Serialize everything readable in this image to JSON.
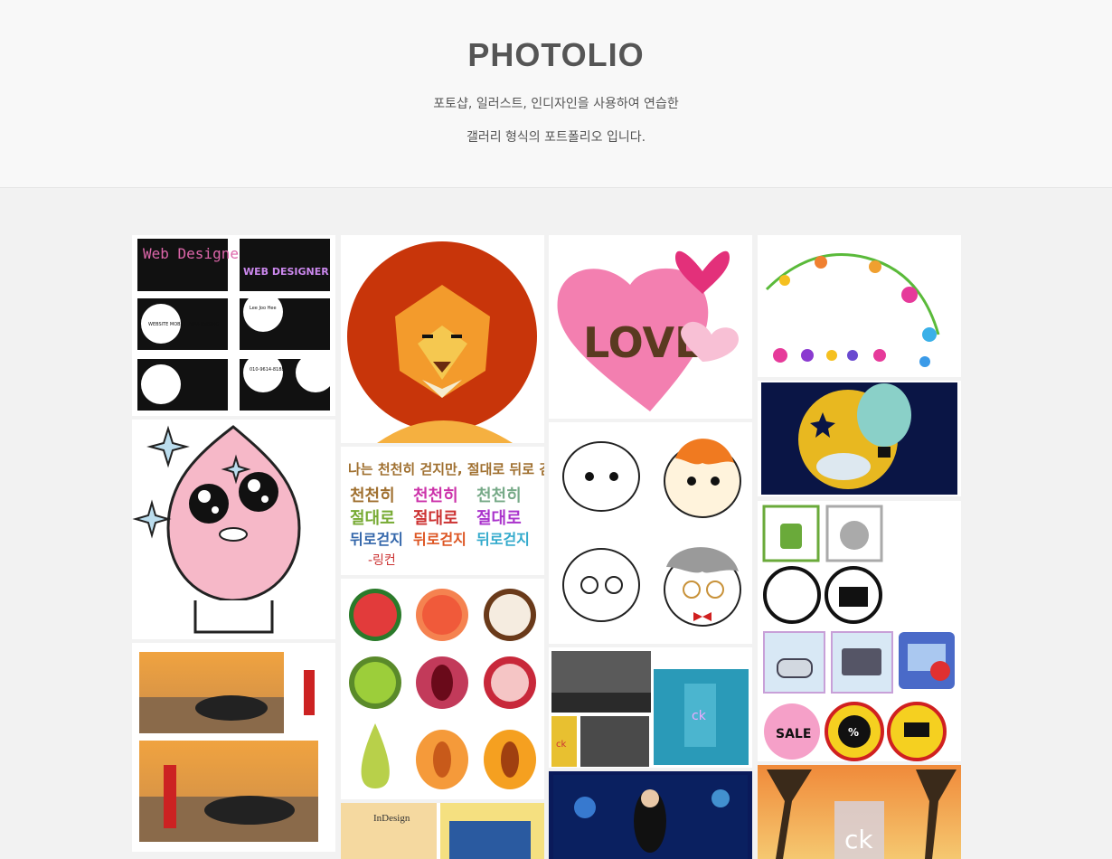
{
  "header": {
    "title": "PHOTOLIO",
    "subtitle_line1": "포토샵, 일러스트, 인디자인을 사용하여 연습한",
    "subtitle_line2": "갤러리 형식의 포트폴리오 입니다."
  },
  "gallery": {
    "items": [
      {
        "text_a": "Web Designer",
        "text_b": "WEB DESIGNER",
        "name": "Lee Joo Hee",
        "phone": "010-9614-8188",
        "small": "WEBSITE MOBILE ADVERTISING"
      },
      {
        "text": ""
      },
      {
        "text": "LOVE"
      },
      {
        "text": ""
      },
      {
        "text": ""
      },
      {
        "text_1": "나는 천천히 걷지만, 절대로 뒤로 걷지 않는다",
        "text_2": "-링컨"
      },
      {
        "text": ""
      },
      {
        "text": ""
      },
      {
        "text": ""
      },
      {
        "text": "ck",
        "text_2": "ck"
      },
      {
        "text": ""
      },
      {
        "text_1": "InDesign"
      },
      {
        "text": ""
      },
      {
        "text": "ck"
      }
    ],
    "icon_texts": {
      "sale": "SALE",
      "percent": "%"
    }
  },
  "colors": {
    "title": "#555555",
    "header_bg": "#f8f8f8",
    "page_bg": "#f2f2f2"
  }
}
